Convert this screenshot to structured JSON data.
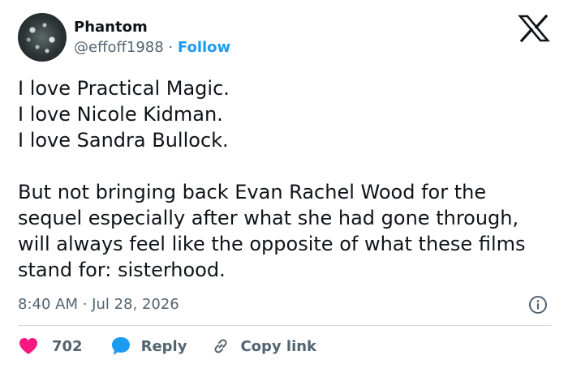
{
  "author": {
    "name": "Phantom",
    "handle": "@effoff1988",
    "separator": "·",
    "follow_label": "Follow"
  },
  "tweet": {
    "text": "I love Practical Magic.\nI love Nicole Kidman.\nI love Sandra Bullock.\n\nBut not bringing back Evan Rachel Wood for the sequel especially after what she had gone through, will always feel like the opposite of what these films stand for: sisterhood.",
    "timestamp": "8:40 AM · Jul 28, 2026"
  },
  "actions": {
    "like_count": "702",
    "reply_label": "Reply",
    "copy_link_label": "Copy link"
  },
  "icons": [
    "x-logo-icon",
    "info-icon",
    "heart-icon",
    "reply-bubble-icon",
    "link-icon"
  ],
  "colors": {
    "accent": "#1d9bf0",
    "like": "#f91880",
    "secondary_text": "#536471",
    "primary_text": "#0f1419",
    "divider": "#cfd9de"
  }
}
